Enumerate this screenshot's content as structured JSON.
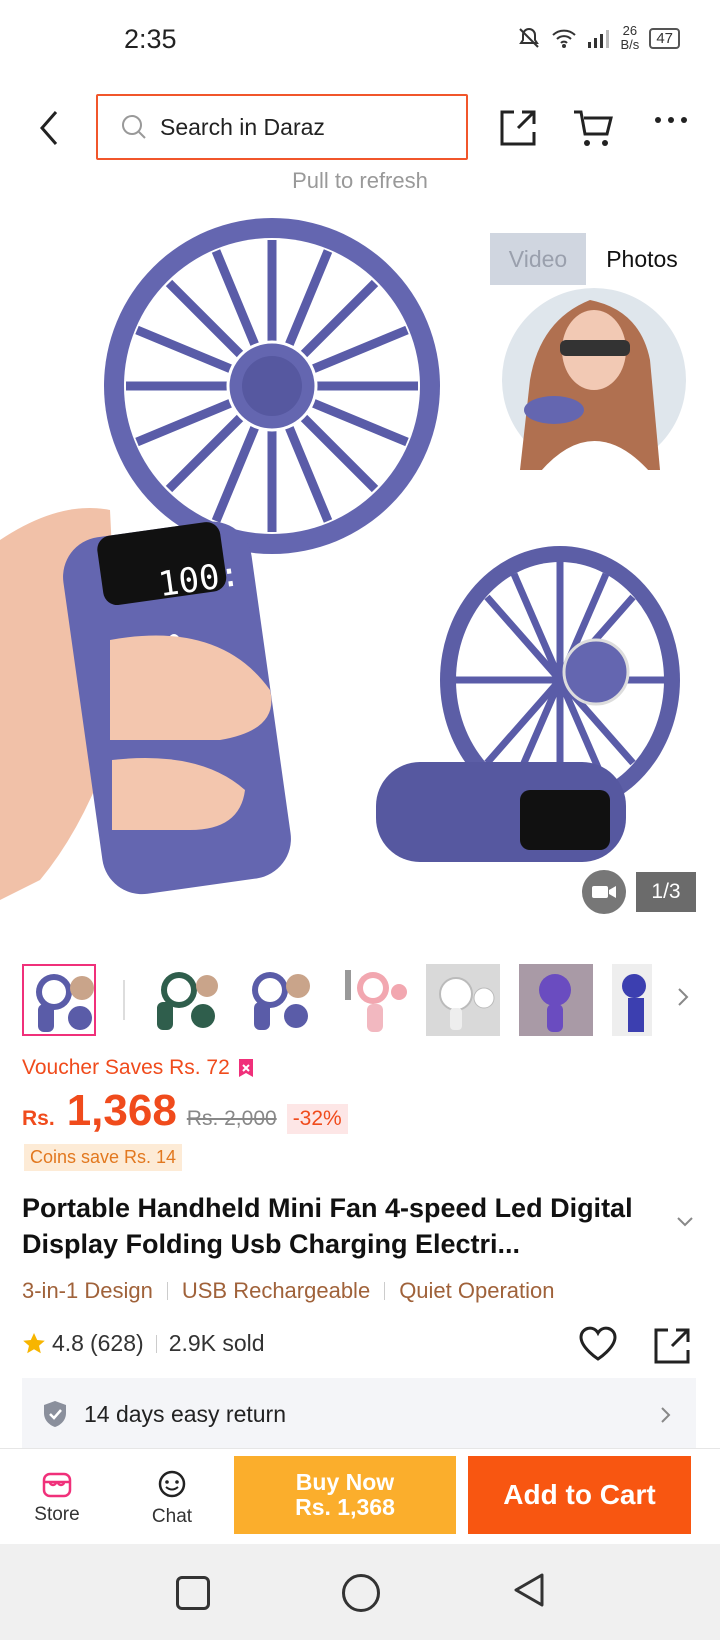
{
  "status_bar": {
    "time": "2:35",
    "net_speed_value": "26",
    "net_speed_unit": "B/s",
    "battery": "47"
  },
  "header": {
    "search_placeholder": "Search in Daraz",
    "pull_text": "Pull to refresh"
  },
  "gallery": {
    "tab_video": "Video",
    "tab_photos": "Photos",
    "counter": "1/3",
    "display_text": "100:",
    "thumbnail_count": 7,
    "selected_thumbnail": 1
  },
  "pricing": {
    "voucher": "Voucher Saves Rs. 72",
    "currency": "Rs.",
    "price": "1,368",
    "original_price": "Rs. 2,000",
    "discount": "-32%",
    "coins": "Coins save Rs. 14"
  },
  "product": {
    "title": "Portable Handheld Mini Fan 4-speed Led Digital Display Folding Usb Charging Electri...",
    "features": [
      "3-in-1 Design",
      "USB Rechargeable",
      "Quiet Operation"
    ],
    "rating": "4.8",
    "reviews": "(628)",
    "sold": "2.9K sold"
  },
  "return_policy": {
    "text": "14 days easy return"
  },
  "bottom_bar": {
    "store_label": "Store",
    "chat_label": "Chat",
    "buy_now_line1": "Buy Now",
    "buy_now_line2": "Rs. 1,368",
    "add_to_cart": "Add to Cart"
  },
  "colors": {
    "accent": "#f85611",
    "buy_now": "#fbae2c",
    "price": "#f04b1c",
    "fan": "#5a5ca8"
  }
}
